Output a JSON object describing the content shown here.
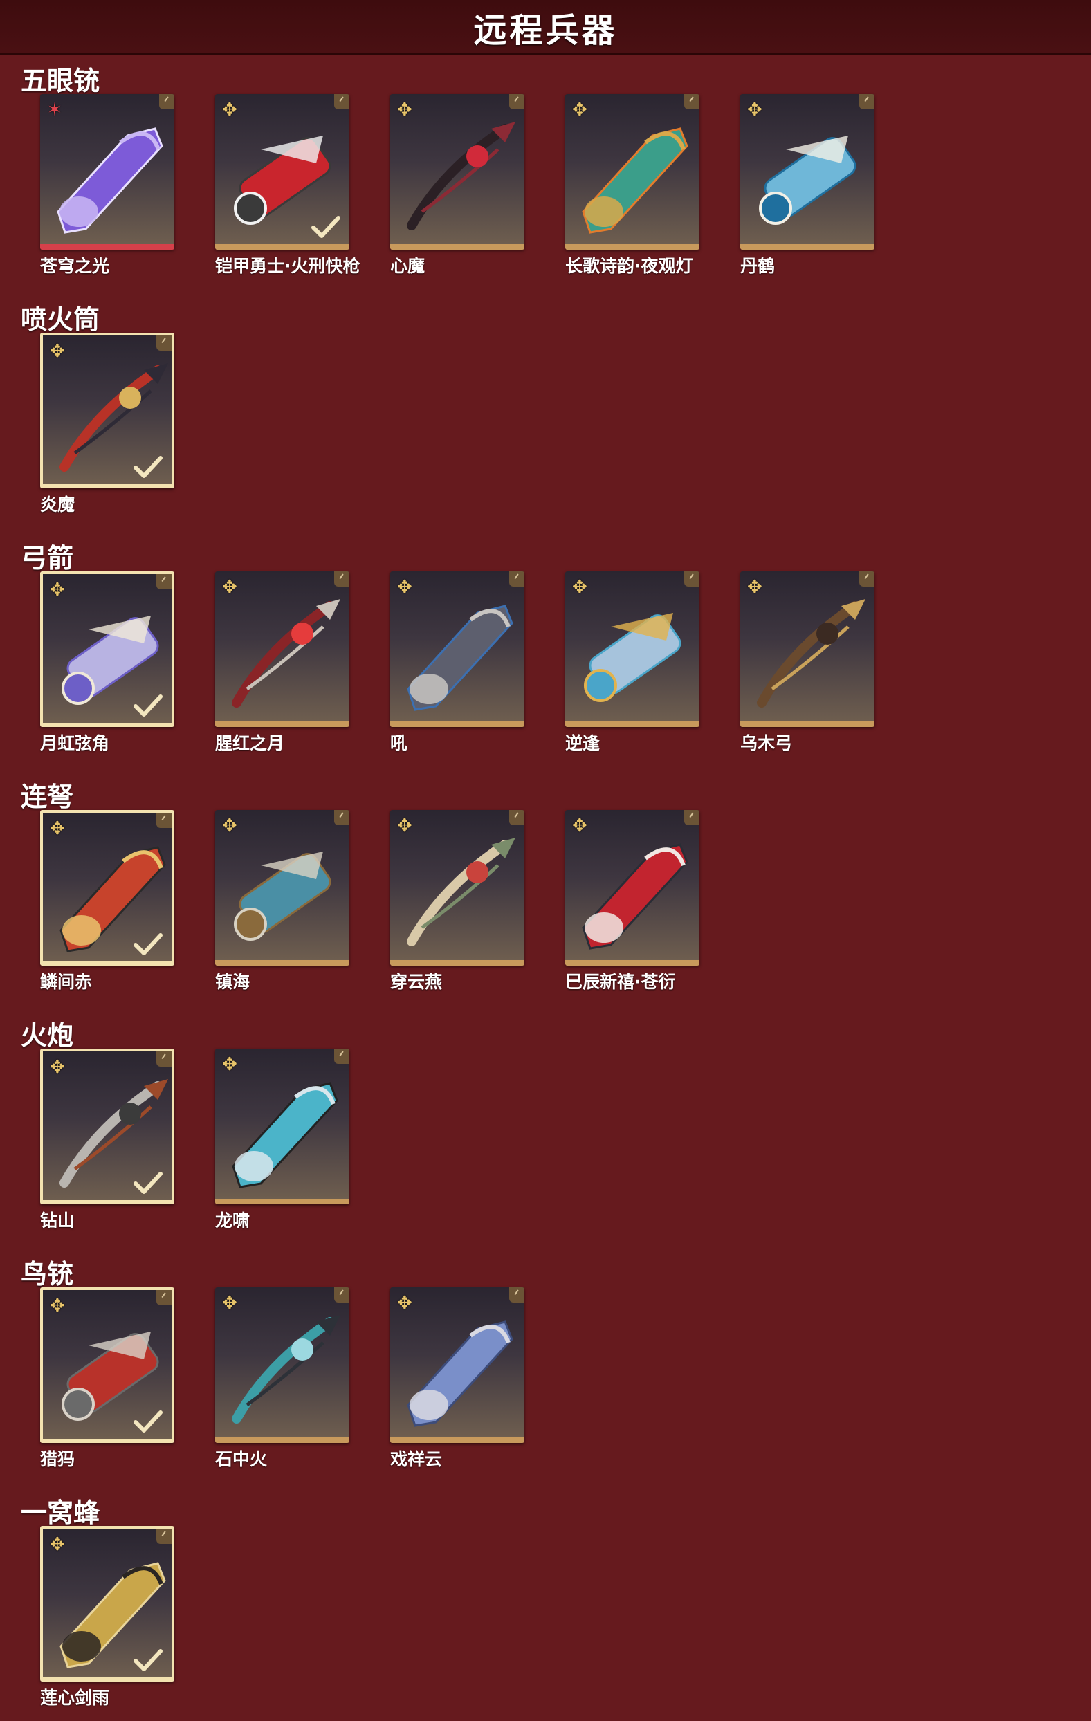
{
  "header": {
    "title": "远程兵器"
  },
  "colors": {
    "background": "#661a1e",
    "header": "#3e0c0e",
    "card_border": "#c89a5c",
    "selected_border": "#f3e2b0",
    "rarity_gold": "#e8c46a",
    "rarity_red": "#e0434d"
  },
  "sections": [
    {
      "title": "五眼铳",
      "items": [
        {
          "name": "苍穹之光",
          "rarity_icon": "red-star-icon",
          "selected": false,
          "checked": false,
          "art": "purple-mystic-gun"
        },
        {
          "name": "铠甲勇士·火刑快枪",
          "rarity_icon": "gold-star-icon",
          "selected": false,
          "checked": true,
          "art": "red-mech-gun"
        },
        {
          "name": "心魔",
          "rarity_icon": "gold-star-icon",
          "selected": false,
          "checked": false,
          "art": "dark-demon-gun"
        },
        {
          "name": "长歌诗韵·夜观灯",
          "rarity_icon": "gold-star-icon",
          "selected": false,
          "checked": false,
          "art": "jade-fish-gun"
        },
        {
          "name": "丹鹤",
          "rarity_icon": "gold-star-icon",
          "selected": false,
          "checked": false,
          "art": "crane-porcelain-gun"
        }
      ]
    },
    {
      "title": "喷火筒",
      "items": [
        {
          "name": "炎魔",
          "rarity_icon": "gold-star-icon",
          "selected": true,
          "checked": true,
          "art": "red-flame-tube"
        }
      ]
    },
    {
      "title": "弓箭",
      "items": [
        {
          "name": "月虹弦角",
          "rarity_icon": "gold-star-icon",
          "selected": true,
          "checked": true,
          "art": "moon-bow"
        },
        {
          "name": "腥红之月",
          "rarity_icon": "gold-star-icon",
          "selected": false,
          "checked": false,
          "art": "crimson-bow"
        },
        {
          "name": "吼",
          "rarity_icon": "gold-star-icon",
          "selected": false,
          "checked": false,
          "art": "roar-bow"
        },
        {
          "name": "逆逢",
          "rarity_icon": "gold-star-icon",
          "selected": false,
          "checked": false,
          "art": "azure-bow"
        },
        {
          "name": "乌木弓",
          "rarity_icon": "gold-star-icon",
          "selected": false,
          "checked": false,
          "art": "ebony-bow"
        }
      ]
    },
    {
      "title": "连弩",
      "items": [
        {
          "name": "鳞间赤",
          "rarity_icon": "gold-star-icon",
          "selected": true,
          "checked": true,
          "art": "red-carp-crossbow"
        },
        {
          "name": "镇海",
          "rarity_icon": "gold-star-icon",
          "selected": false,
          "checked": false,
          "art": "sea-crossbow"
        },
        {
          "name": "穿云燕",
          "rarity_icon": "gold-star-icon",
          "selected": false,
          "checked": false,
          "art": "swallow-crossbow"
        },
        {
          "name": "巳辰新禧·苍衍",
          "rarity_icon": "gold-star-icon",
          "selected": false,
          "checked": false,
          "art": "serpent-crossbow"
        }
      ]
    },
    {
      "title": "火炮",
      "items": [
        {
          "name": "钻山",
          "rarity_icon": "gold-star-icon",
          "selected": true,
          "checked": true,
          "art": "silver-cannon"
        },
        {
          "name": "龙啸",
          "rarity_icon": "gold-star-icon",
          "selected": false,
          "checked": false,
          "art": "dragon-cannon"
        }
      ]
    },
    {
      "title": "鸟铳",
      "items": [
        {
          "name": "猎犸",
          "rarity_icon": "gold-star-icon",
          "selected": true,
          "checked": true,
          "art": "red-musket"
        },
        {
          "name": "石中火",
          "rarity_icon": "gold-star-icon",
          "selected": false,
          "checked": false,
          "art": "teal-musket"
        },
        {
          "name": "戏祥云",
          "rarity_icon": "gold-star-icon",
          "selected": false,
          "checked": false,
          "art": "cloud-musket"
        }
      ]
    },
    {
      "title": "一窝蜂",
      "items": [
        {
          "name": "莲心剑雨",
          "rarity_icon": "gold-star-icon",
          "selected": true,
          "checked": true,
          "art": "lotus-rocket"
        }
      ]
    }
  ]
}
